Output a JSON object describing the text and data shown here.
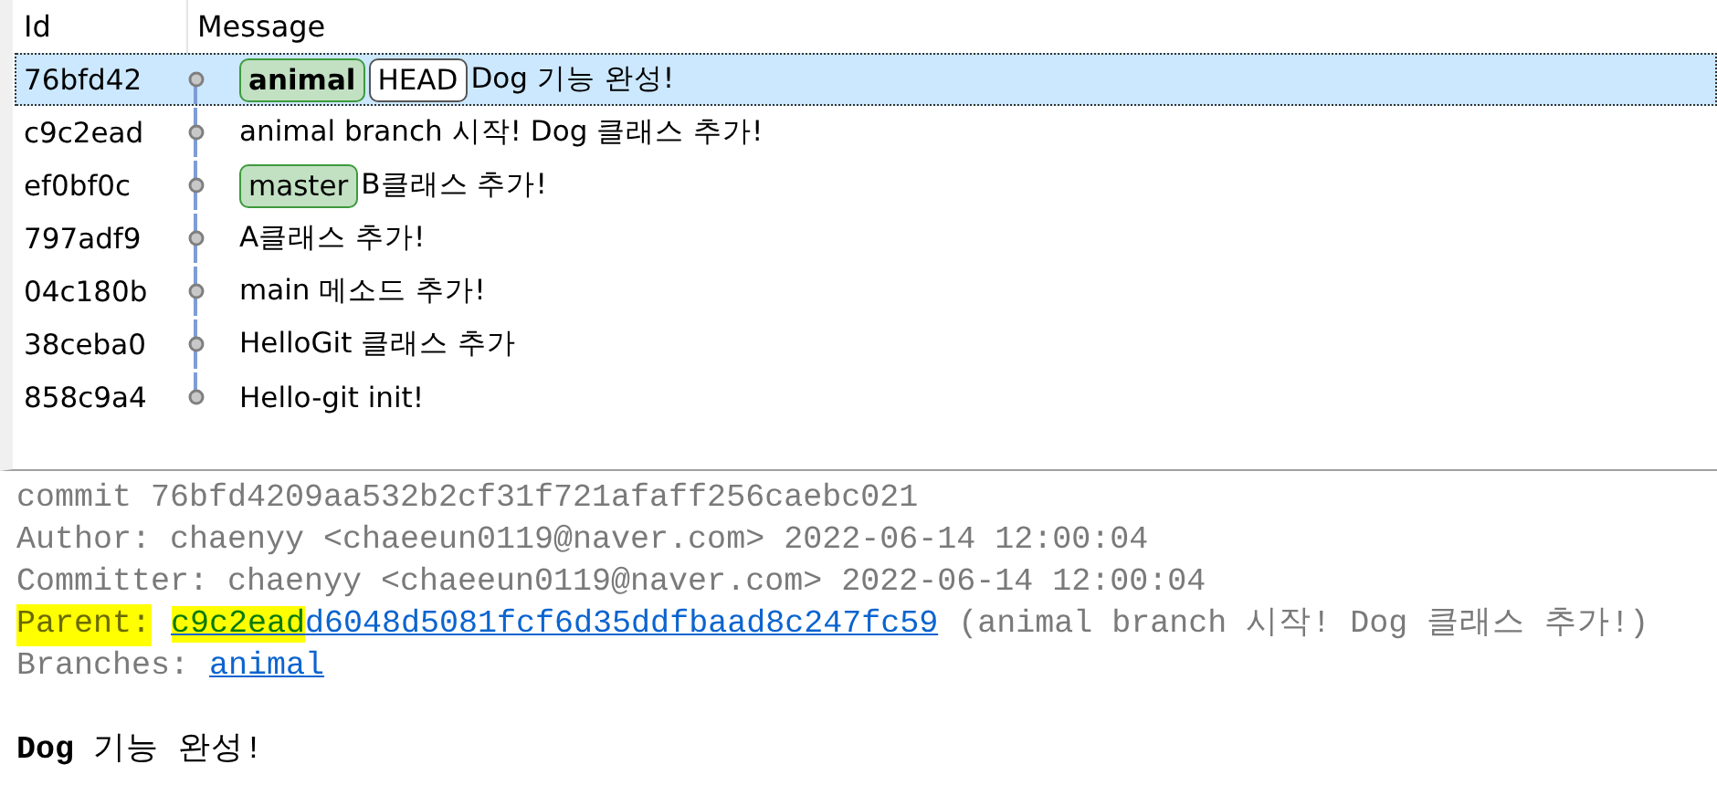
{
  "columns": [
    "Id",
    "Message"
  ],
  "commits": [
    {
      "id": "76bfd42",
      "selected": true,
      "refs": [
        {
          "kind": "current_branch",
          "label": "animal"
        },
        {
          "kind": "head",
          "label": "HEAD"
        }
      ],
      "message": "Dog 기능 완성!"
    },
    {
      "id": "c9c2ead",
      "selected": false,
      "message": "animal branch 시작! Dog 클래스 추가!"
    },
    {
      "id": "ef0bf0c",
      "selected": false,
      "refs": [
        {
          "kind": "branch",
          "label": "master"
        }
      ],
      "message": "B클래스 추가!"
    },
    {
      "id": "797adf9",
      "selected": false,
      "message": "A클래스 추가!"
    },
    {
      "id": "04c180b",
      "selected": false,
      "message": "main 메소드 추가!"
    },
    {
      "id": "38ceba0",
      "selected": false,
      "message": "HelloGit 클래스 추가"
    },
    {
      "id": "858c9a4",
      "selected": false,
      "message": "Hello-git init!"
    }
  ],
  "details": {
    "lines": [
      "commit 76bfd4209aa532b2cf31f721afaff256caebc021",
      "Author: chaenyy <chaeeun0119@naver.com> 2022-06-14 12:00:04",
      "Committer: chaenyy <chaeeun0119@naver.com> 2022-06-14 12:00:04"
    ],
    "parent": {
      "label": "Parent:",
      "highlighted": true,
      "hash_match": "c9c2ead",
      "hash_rest": "d6048d5081fcf6d35ddfbaad8c247fc59",
      "subject": "(animal branch 시작! Dog 클래스 추가!)"
    },
    "branches": {
      "label": "Branches:",
      "link": "animal"
    },
    "message": "**Dog** 기능 완성!"
  }
}
